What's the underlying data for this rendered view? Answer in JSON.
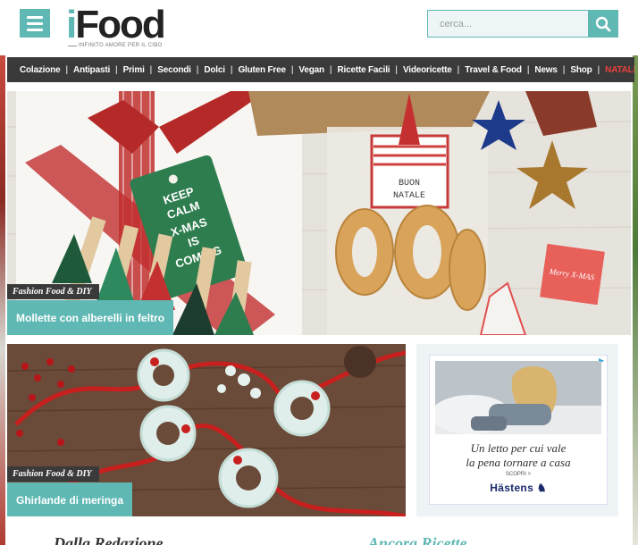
{
  "header": {
    "logo_i": "i",
    "logo_rest": "Food",
    "logo_tagline": "INFINITO AMORE PER IL CIBO",
    "search_placeholder": "cerca..."
  },
  "nav": {
    "items": [
      {
        "label": "Colazione",
        "special": false
      },
      {
        "label": "Antipasti",
        "special": false
      },
      {
        "label": "Primi",
        "special": false
      },
      {
        "label": "Secondi",
        "special": false
      },
      {
        "label": "Dolci",
        "special": false
      },
      {
        "label": "Gluten Free",
        "special": false
      },
      {
        "label": "Vegan",
        "special": false
      },
      {
        "label": "Ricette Facili",
        "special": false
      },
      {
        "label": "Videoricette",
        "special": false
      },
      {
        "label": "Travel & Food",
        "special": false
      },
      {
        "label": "News",
        "special": false
      },
      {
        "label": "Shop",
        "special": false
      },
      {
        "label": "NATALE",
        "special": true
      }
    ]
  },
  "hero": {
    "category": "Fashion Food & DIY",
    "title": "Mollette con alberelli in feltro",
    "photo_texts": {
      "tag_line1": "KEEP",
      "tag_line2": "CALM",
      "tag_line3": "X-MAS",
      "tag_line4": "IS",
      "tag_line5": "COMING",
      "bag_line1": "BUON",
      "bag_line2": "NATALE",
      "card_text": "Merry X-MAS"
    }
  },
  "card2": {
    "category": "Fashion Food & DIY",
    "title": "Ghirlande di meringa"
  },
  "ad": {
    "line1": "Un letto per cui vale",
    "line2": "la pena tornare a casa",
    "cta": "SCOPRI >",
    "brand": "Hästens"
  },
  "bottom": {
    "left_heading": "Dalla Redazione",
    "right_heading": "Ancora Ricette"
  },
  "colors": {
    "accent": "#5fb8b4",
    "nav_bg": "#3a3a3a",
    "special": "#e8403a"
  }
}
